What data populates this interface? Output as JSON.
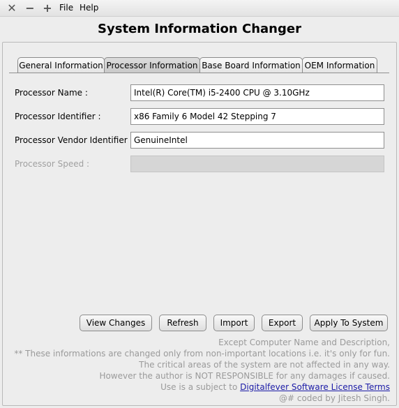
{
  "menu": {
    "file": "File",
    "help": "Help"
  },
  "window_controls": {
    "close": "close-icon",
    "minimize": "minimize-icon",
    "maximize": "maximize-icon"
  },
  "app": {
    "title": "System Information Changer"
  },
  "tabs": [
    {
      "label": "General Information",
      "active": false
    },
    {
      "label": "Processor Information",
      "active": true
    },
    {
      "label": "Base Board Information",
      "active": false
    },
    {
      "label": "OEM Information",
      "active": false
    }
  ],
  "fields": [
    {
      "label": "Processor Name :",
      "value": "Intel(R) Core(TM) i5-2400 CPU @ 3.10GHz",
      "enabled": true
    },
    {
      "label": "Processor Identifier :",
      "value": "x86 Family 6 Model 42 Stepping 7",
      "enabled": true
    },
    {
      "label": "Processor Vendor Identifier :",
      "value": "GenuineIntel",
      "enabled": true
    },
    {
      "label": "Processor Speed :",
      "value": "",
      "enabled": false
    }
  ],
  "buttons": {
    "view_changes": "View Changes",
    "refresh": "Refresh",
    "import": "Import",
    "export": "Export",
    "apply": "Apply To System"
  },
  "notes": {
    "line1": "Except Computer Name and Description,",
    "line2": "** These informations are changed only from non-important locations i.e. it's only for fun.",
    "line3": "The critical areas of the system are not affected in any way.",
    "line4": "However the author is NOT RESPONSIBLE for any damages if caused.",
    "line5_prefix": "Use is a subject to ",
    "license_link": "Digitalfever Software License Terms",
    "line6": "@# coded by Jitesh Singh."
  }
}
